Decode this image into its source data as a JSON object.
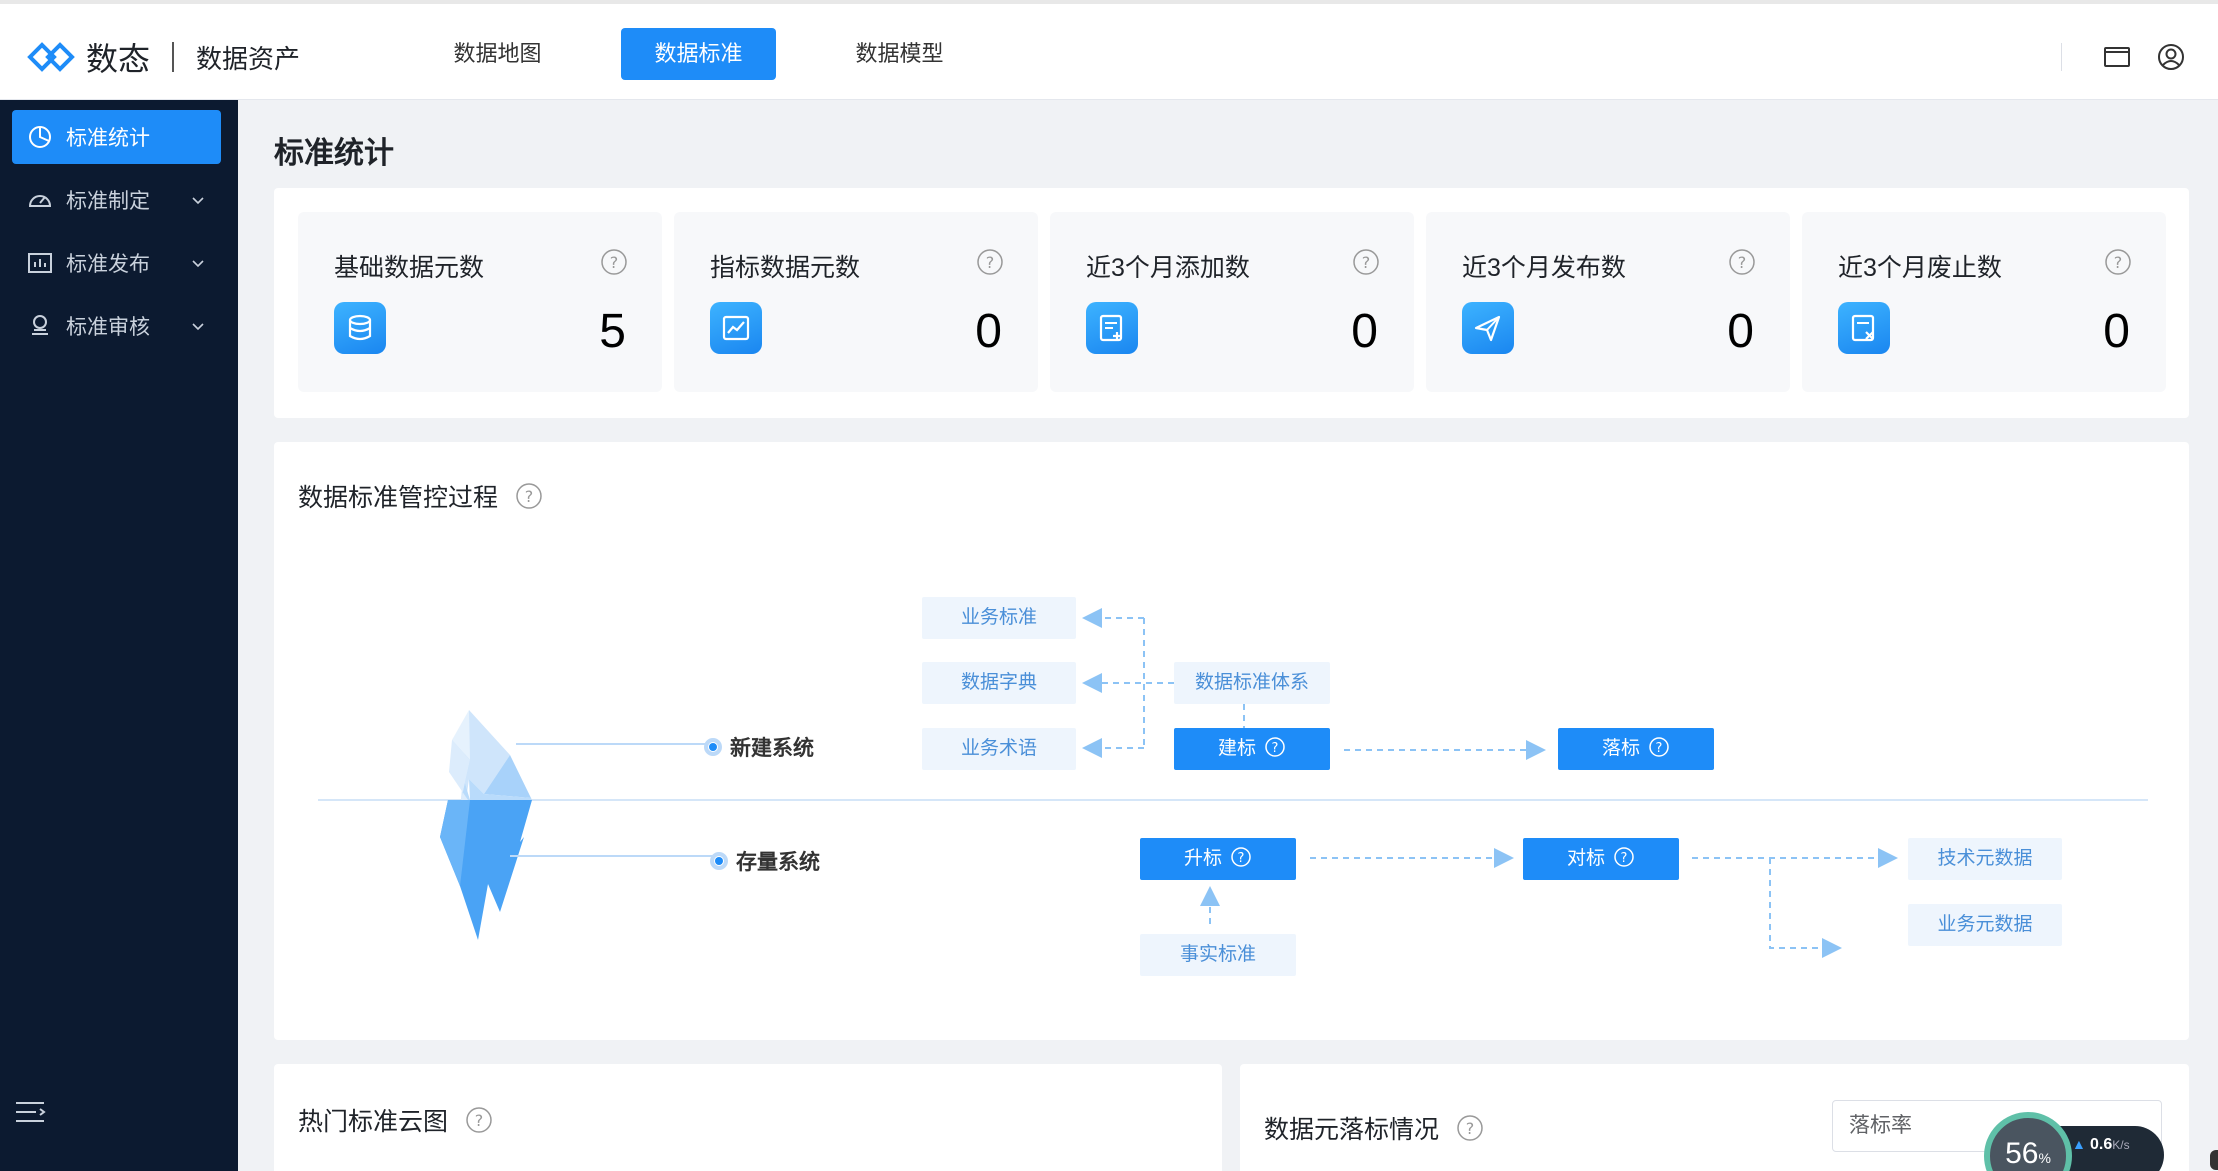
{
  "header": {
    "logo_text": "数态",
    "logo_sub": "数据资产",
    "nav": [
      {
        "label": "数据地图",
        "active": false
      },
      {
        "label": "数据标准",
        "active": true
      },
      {
        "label": "数据模型",
        "active": false
      }
    ],
    "icons": [
      "window-icon",
      "user-icon"
    ]
  },
  "sidebar": {
    "items": [
      {
        "label": "标准统计",
        "icon": "pie-chart-icon",
        "active": true
      },
      {
        "label": "标准制定",
        "icon": "dashboard-icon",
        "active": false
      },
      {
        "label": "标准发布",
        "icon": "bar-chart-icon",
        "active": false
      },
      {
        "label": "标准审核",
        "icon": "stamp-icon",
        "active": false
      }
    ],
    "collapse_icon": "menu-collapse-icon"
  },
  "page": {
    "title": "标准统计"
  },
  "stats": [
    {
      "label": "基础数据元数",
      "value": "5",
      "icon": "database-icon"
    },
    {
      "label": "指标数据元数",
      "value": "0",
      "icon": "line-chart-icon"
    },
    {
      "label": "近3个月添加数",
      "value": "0",
      "icon": "document-add-icon"
    },
    {
      "label": "近3个月发布数",
      "value": "0",
      "icon": "send-icon"
    },
    {
      "label": "近3个月废止数",
      "value": "0",
      "icon": "document-remove-icon"
    }
  ],
  "process": {
    "title": "数据标准管控过程",
    "new_system": "新建系统",
    "existing_system": "存量系统",
    "business_standard": "业务标准",
    "data_dictionary": "数据字典",
    "business_terms": "业务术语",
    "standard_system": "数据标准体系",
    "build": "建标",
    "land": "落标",
    "upgrade": "升标",
    "align": "对标",
    "fact_standard": "事实标准",
    "tech_metadata": "技术元数据",
    "business_metadata": "业务元数据"
  },
  "hot_cloud": {
    "title": "热门标准云图"
  },
  "landing": {
    "title": "数据元落标情况",
    "select_value": "落标率"
  },
  "net_widget": {
    "percent": "56",
    "percent_unit": "%",
    "speed": "0.6",
    "speed_unit": "K/s"
  },
  "colors": {
    "primary": "#1e8cf8",
    "sidebar_bg": "#0c1a30",
    "light_box": "#eef5fd"
  }
}
